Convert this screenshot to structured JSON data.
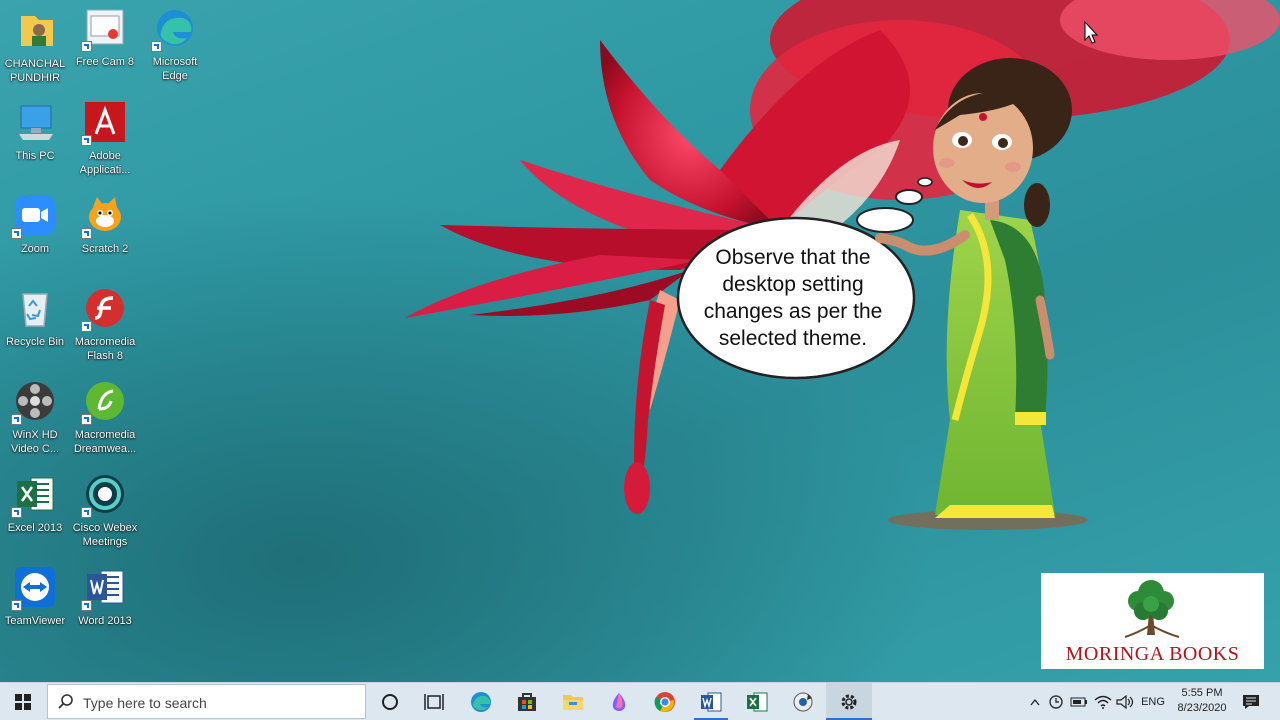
{
  "desktop": {
    "icons": [
      {
        "label": "CHANCHAL\nPUNDHIR",
        "icon": "user-folder-icon"
      },
      {
        "label": "Free Cam 8",
        "icon": "free-cam-icon"
      },
      {
        "label": "Microsoft\nEdge",
        "icon": "edge-icon"
      },
      {
        "label": "This PC",
        "icon": "this-pc-icon"
      },
      {
        "label": "Adobe\nApplicati...",
        "icon": "adobe-icon"
      },
      {
        "label": "Zoom",
        "icon": "zoom-icon"
      },
      {
        "label": "Scratch 2",
        "icon": "scratch-icon"
      },
      {
        "label": "Recycle Bin",
        "icon": "recycle-bin-icon"
      },
      {
        "label": "Macromedia\nFlash 8",
        "icon": "flash-icon"
      },
      {
        "label": "WinX HD\nVideo C...",
        "icon": "winx-video-icon"
      },
      {
        "label": "Macromedia\nDreamwea...",
        "icon": "dreamweaver-icon"
      },
      {
        "label": "Excel 2013",
        "icon": "excel-icon"
      },
      {
        "label": "Cisco Webex\nMeetings",
        "icon": "webex-icon"
      },
      {
        "label": "TeamViewer",
        "icon": "teamviewer-icon"
      },
      {
        "label": "Word 2013",
        "icon": "word-icon"
      }
    ]
  },
  "bubble": {
    "text": "Observe that the desktop setting changes as per the selected theme."
  },
  "logo": {
    "text": "MORINGA BOOKS"
  },
  "taskbar": {
    "search_placeholder": "Type here to search",
    "language": "ENG",
    "time": "5:55 PM",
    "date": "8/23/2020",
    "pinned": [
      "cortana-icon",
      "task-view-icon",
      "edge-icon",
      "store-icon",
      "file-explorer-icon",
      "paint-3d-icon",
      "chrome-icon",
      "word-icon",
      "excel-icon",
      "media-player-icon",
      "settings-icon"
    ]
  },
  "colors": {
    "wallpaper": "#2e98a3",
    "taskbar": "#dde7ef",
    "logo_red": "#b5121b",
    "active_underline": "#2f6fce"
  }
}
